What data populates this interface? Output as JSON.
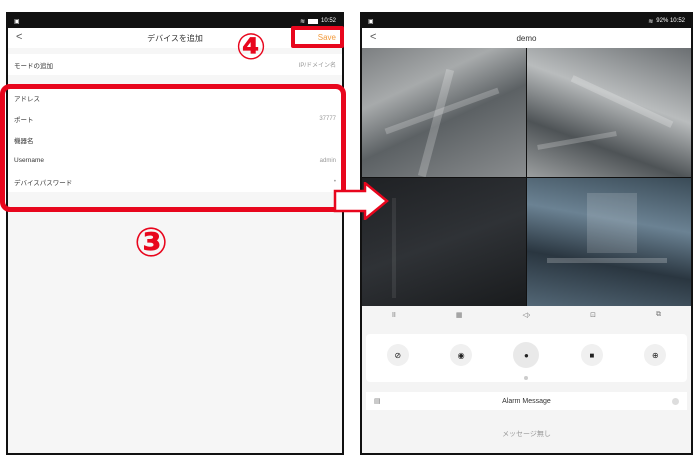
{
  "left_screen": {
    "status_right": "10:52",
    "title": "デバイスを追加",
    "back_glyph": "<",
    "save_label": "Save",
    "rows": [
      {
        "label": "モードの追加",
        "value": "IP/ドメイン名"
      },
      {
        "label": "アドレス",
        "value": ""
      },
      {
        "label": "ポート",
        "value": "37777"
      },
      {
        "label": "機器名",
        "value": ""
      },
      {
        "label": "Username",
        "value": "admin"
      },
      {
        "label": "デバイスパスワード",
        "value": "•"
      }
    ]
  },
  "right_screen": {
    "status_right": "92% 10:52",
    "title": "demo",
    "back_glyph": "<",
    "toolbar": [
      "II",
      "▦",
      "◁›",
      "⊡",
      "⧉"
    ],
    "controls": [
      "⊘",
      "◉",
      "●",
      "■",
      "⊕"
    ],
    "alarm_title": "Alarm Message",
    "empty_message": "メッセージ無し"
  },
  "annotations": {
    "step3": "③",
    "step4": "④"
  },
  "colors": {
    "annotation_red": "#e8061d",
    "save_orange": "#f29a3b"
  }
}
